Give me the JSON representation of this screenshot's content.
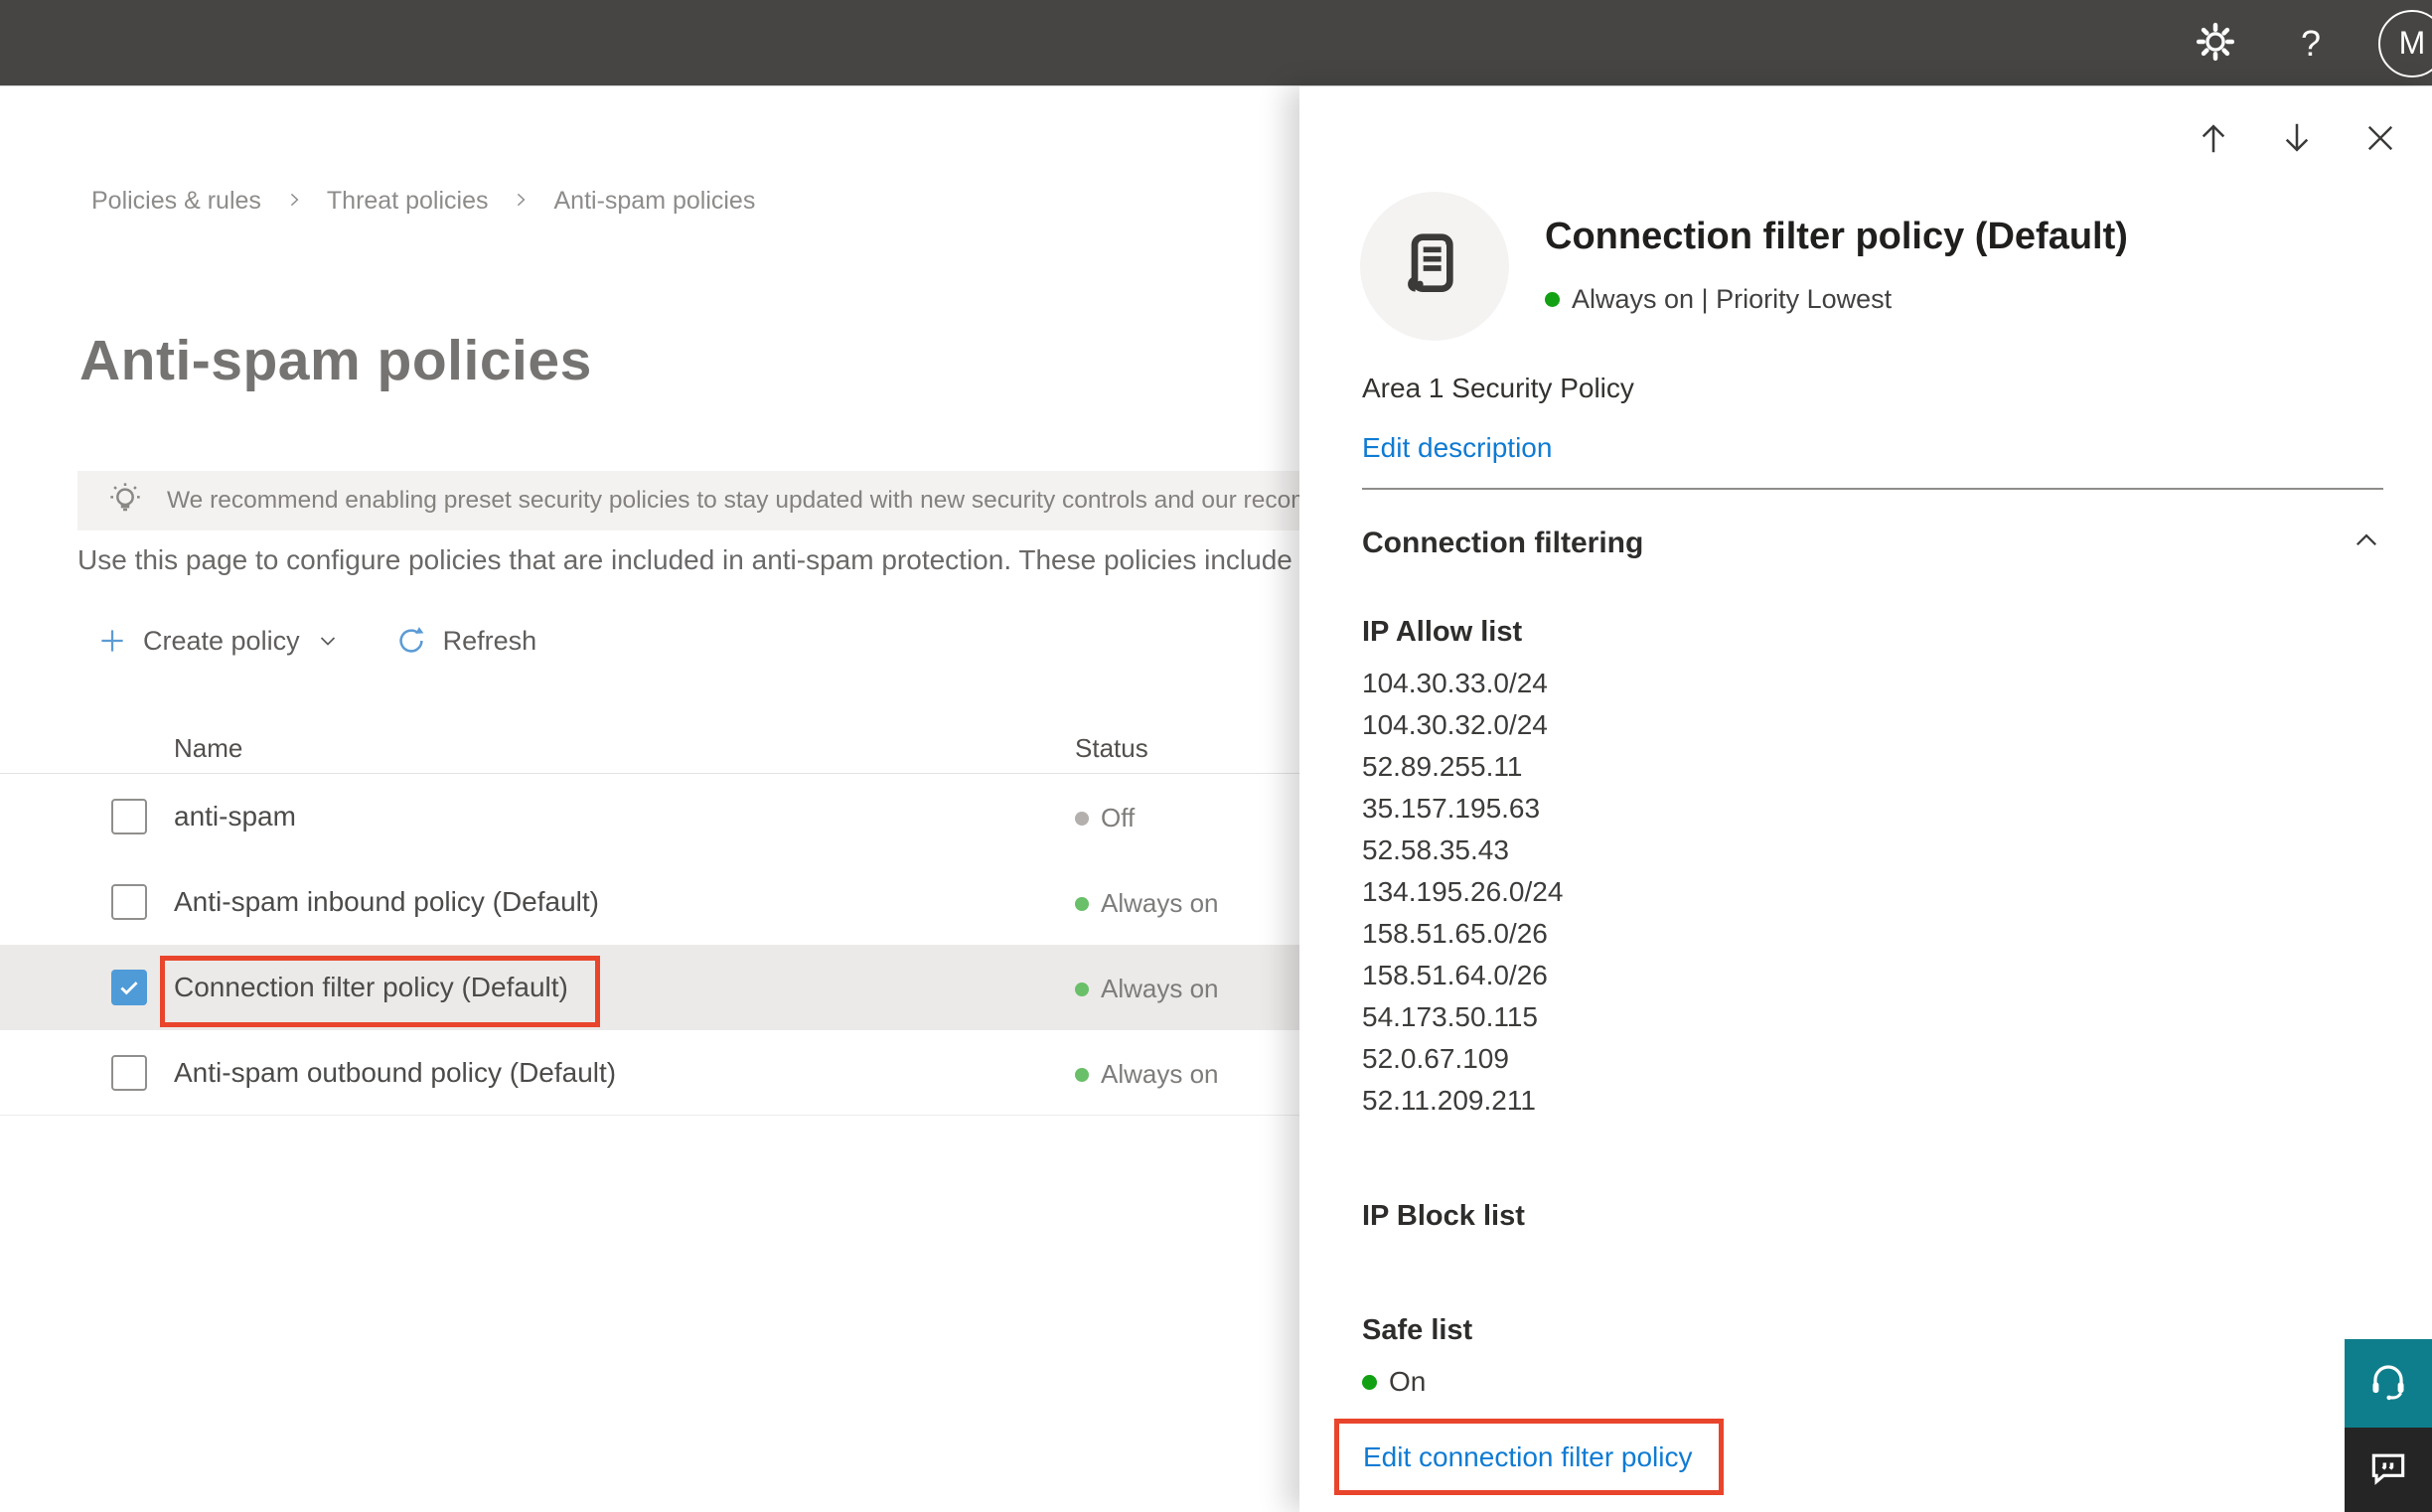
{
  "topbar": {
    "help_glyph": "?",
    "avatar_initial": "M"
  },
  "breadcrumb": {
    "items": [
      "Policies & rules",
      "Threat policies",
      "Anti-spam policies"
    ]
  },
  "page": {
    "title": "Anti-spam policies",
    "banner_text": "We recommend enabling preset security policies to stay updated with new security controls and our recomme",
    "description": "Use this page to configure policies that are included in anti-spam protection. These policies include",
    "toolbar": {
      "create_policy_label": "Create policy",
      "refresh_label": "Refresh"
    }
  },
  "table": {
    "columns": [
      "Name",
      "Status"
    ],
    "rows": [
      {
        "name": "anti-spam",
        "status": "Off",
        "status_color": "gray",
        "checked": false,
        "selected": false
      },
      {
        "name": "Anti-spam inbound policy (Default)",
        "status": "Always on",
        "status_color": "green",
        "checked": false,
        "selected": false
      },
      {
        "name": "Connection filter policy (Default)",
        "status": "Always on",
        "status_color": "green",
        "checked": true,
        "selected": true
      },
      {
        "name": "Anti-spam outbound policy (Default)",
        "status": "Always on",
        "status_color": "green",
        "checked": false,
        "selected": false
      }
    ]
  },
  "flyout": {
    "title": "Connection filter policy (Default)",
    "status_line": "Always on | Priority Lowest",
    "description": "Area 1 Security Policy",
    "edit_description_label": "Edit description",
    "section_title": "Connection filtering",
    "ip_allow_list": {
      "label": "IP Allow list",
      "ips": [
        "104.30.33.0/24",
        "104.30.32.0/24",
        "52.89.255.11",
        "35.157.195.63",
        "52.58.35.43",
        "134.195.26.0/24",
        "158.51.65.0/26",
        "158.51.64.0/26",
        "54.173.50.115",
        "52.0.67.109",
        "52.11.209.211"
      ]
    },
    "ip_block_list": {
      "label": "IP Block list"
    },
    "safe_list": {
      "label": "Safe list",
      "status": "On"
    },
    "edit_link_label": "Edit connection filter policy"
  },
  "colors": {
    "topbar_bg": "#464543",
    "accent_blue": "#0f7bd3",
    "checkbox_blue": "#4e9bd8",
    "status_green_table": "#6abf69",
    "status_green_panel": "#12a112",
    "status_gray": "#b3b0ad",
    "highlight_red": "#e8452c",
    "support_teal": "#0f7e8c",
    "feedback_dark": "#252525",
    "selected_row_bg": "#eceae8"
  }
}
